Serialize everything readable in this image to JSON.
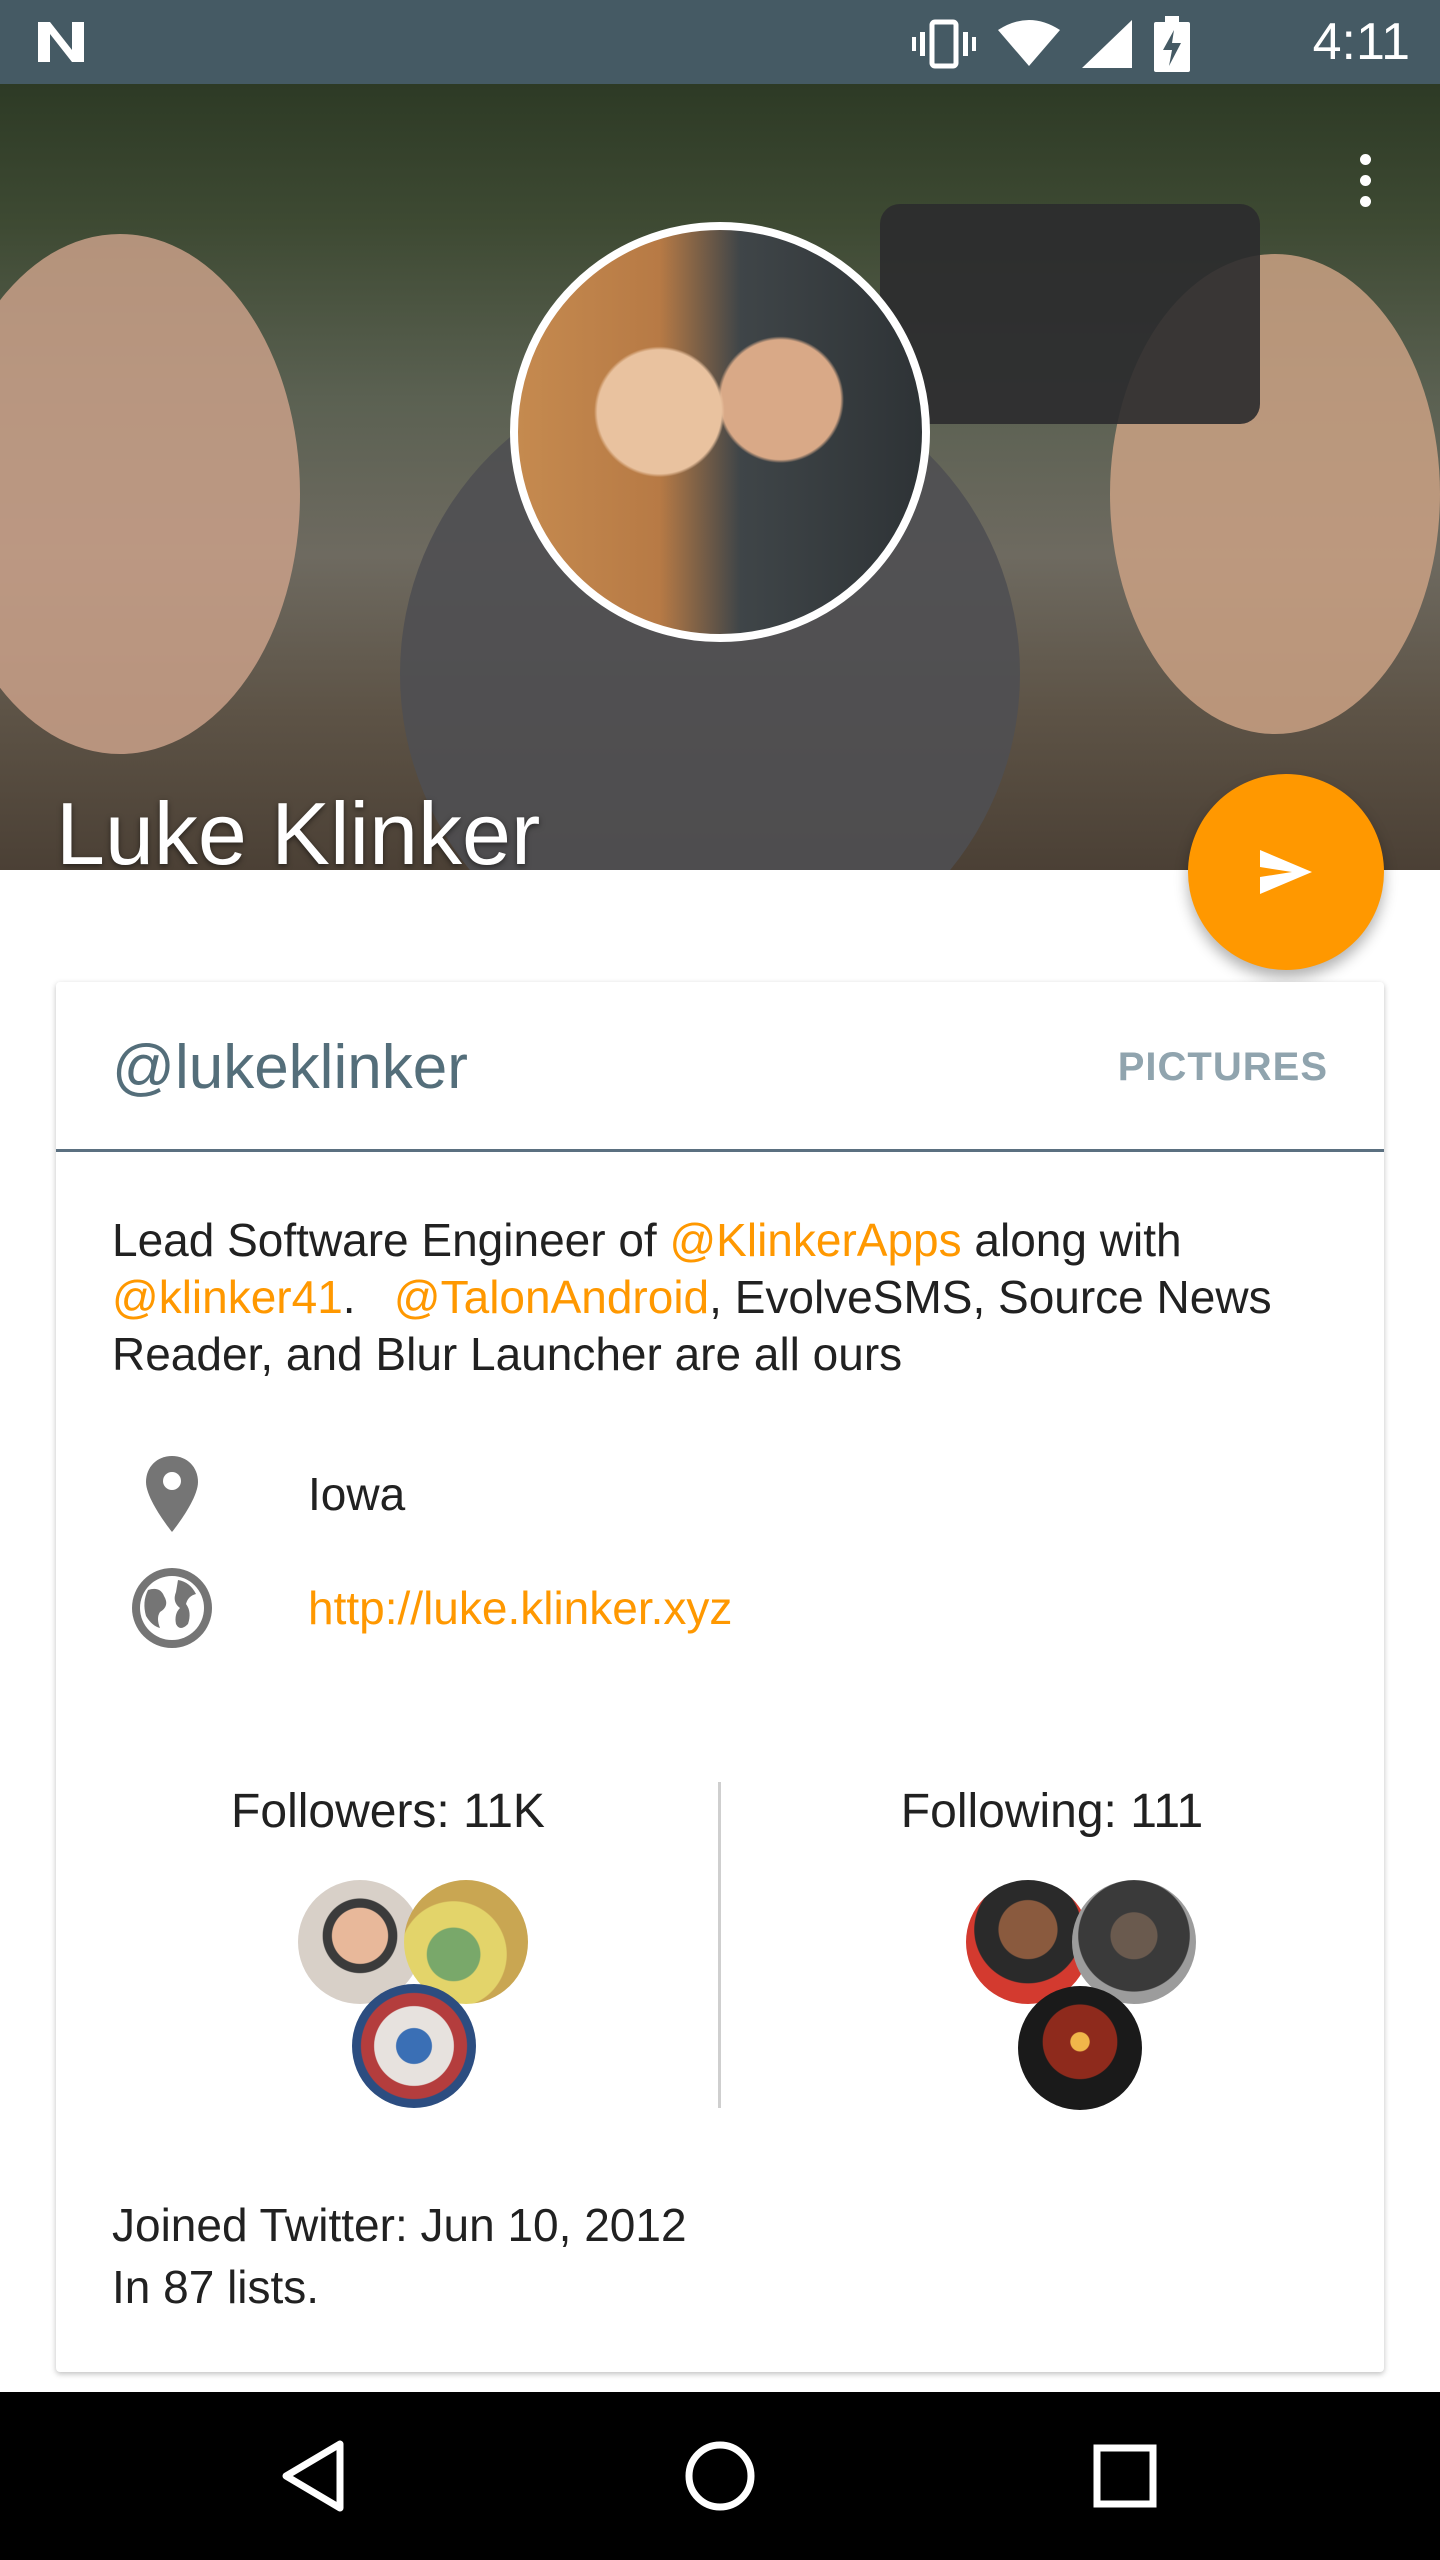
{
  "status_bar": {
    "time": "4:11",
    "icons": [
      "n-logo-icon",
      "vibrate-icon",
      "wifi-icon",
      "cell-signal-icon",
      "battery-charging-icon"
    ]
  },
  "profile": {
    "name": "Luke Klinker",
    "handle": "@lukeklinker",
    "pictures_tab": "PICTURES",
    "bio": {
      "p1": "Lead Software Engineer of ",
      "link1": "@KlinkerApps",
      "p2": " along with ",
      "link2": "@klinker41",
      "p3": ".   ",
      "link3": "@TalonAndroid",
      "p4": ", EvolveSMS, Source News Reader, and Blur Launcher are all ours"
    },
    "location": "Iowa",
    "website": "http://luke.klinker.xyz",
    "followers_label": "Followers: 11K",
    "following_label": "Following: 111",
    "joined": "Joined Twitter: Jun 10, 2012",
    "lists": "In 87 lists."
  },
  "colors": {
    "accent": "#ff9800",
    "primary": "#455a64",
    "handle": "#546e7a"
  },
  "icons": {
    "fab": "send-icon",
    "menu": "more-vert-icon",
    "location": "location-pin-icon",
    "website": "globe-icon"
  }
}
